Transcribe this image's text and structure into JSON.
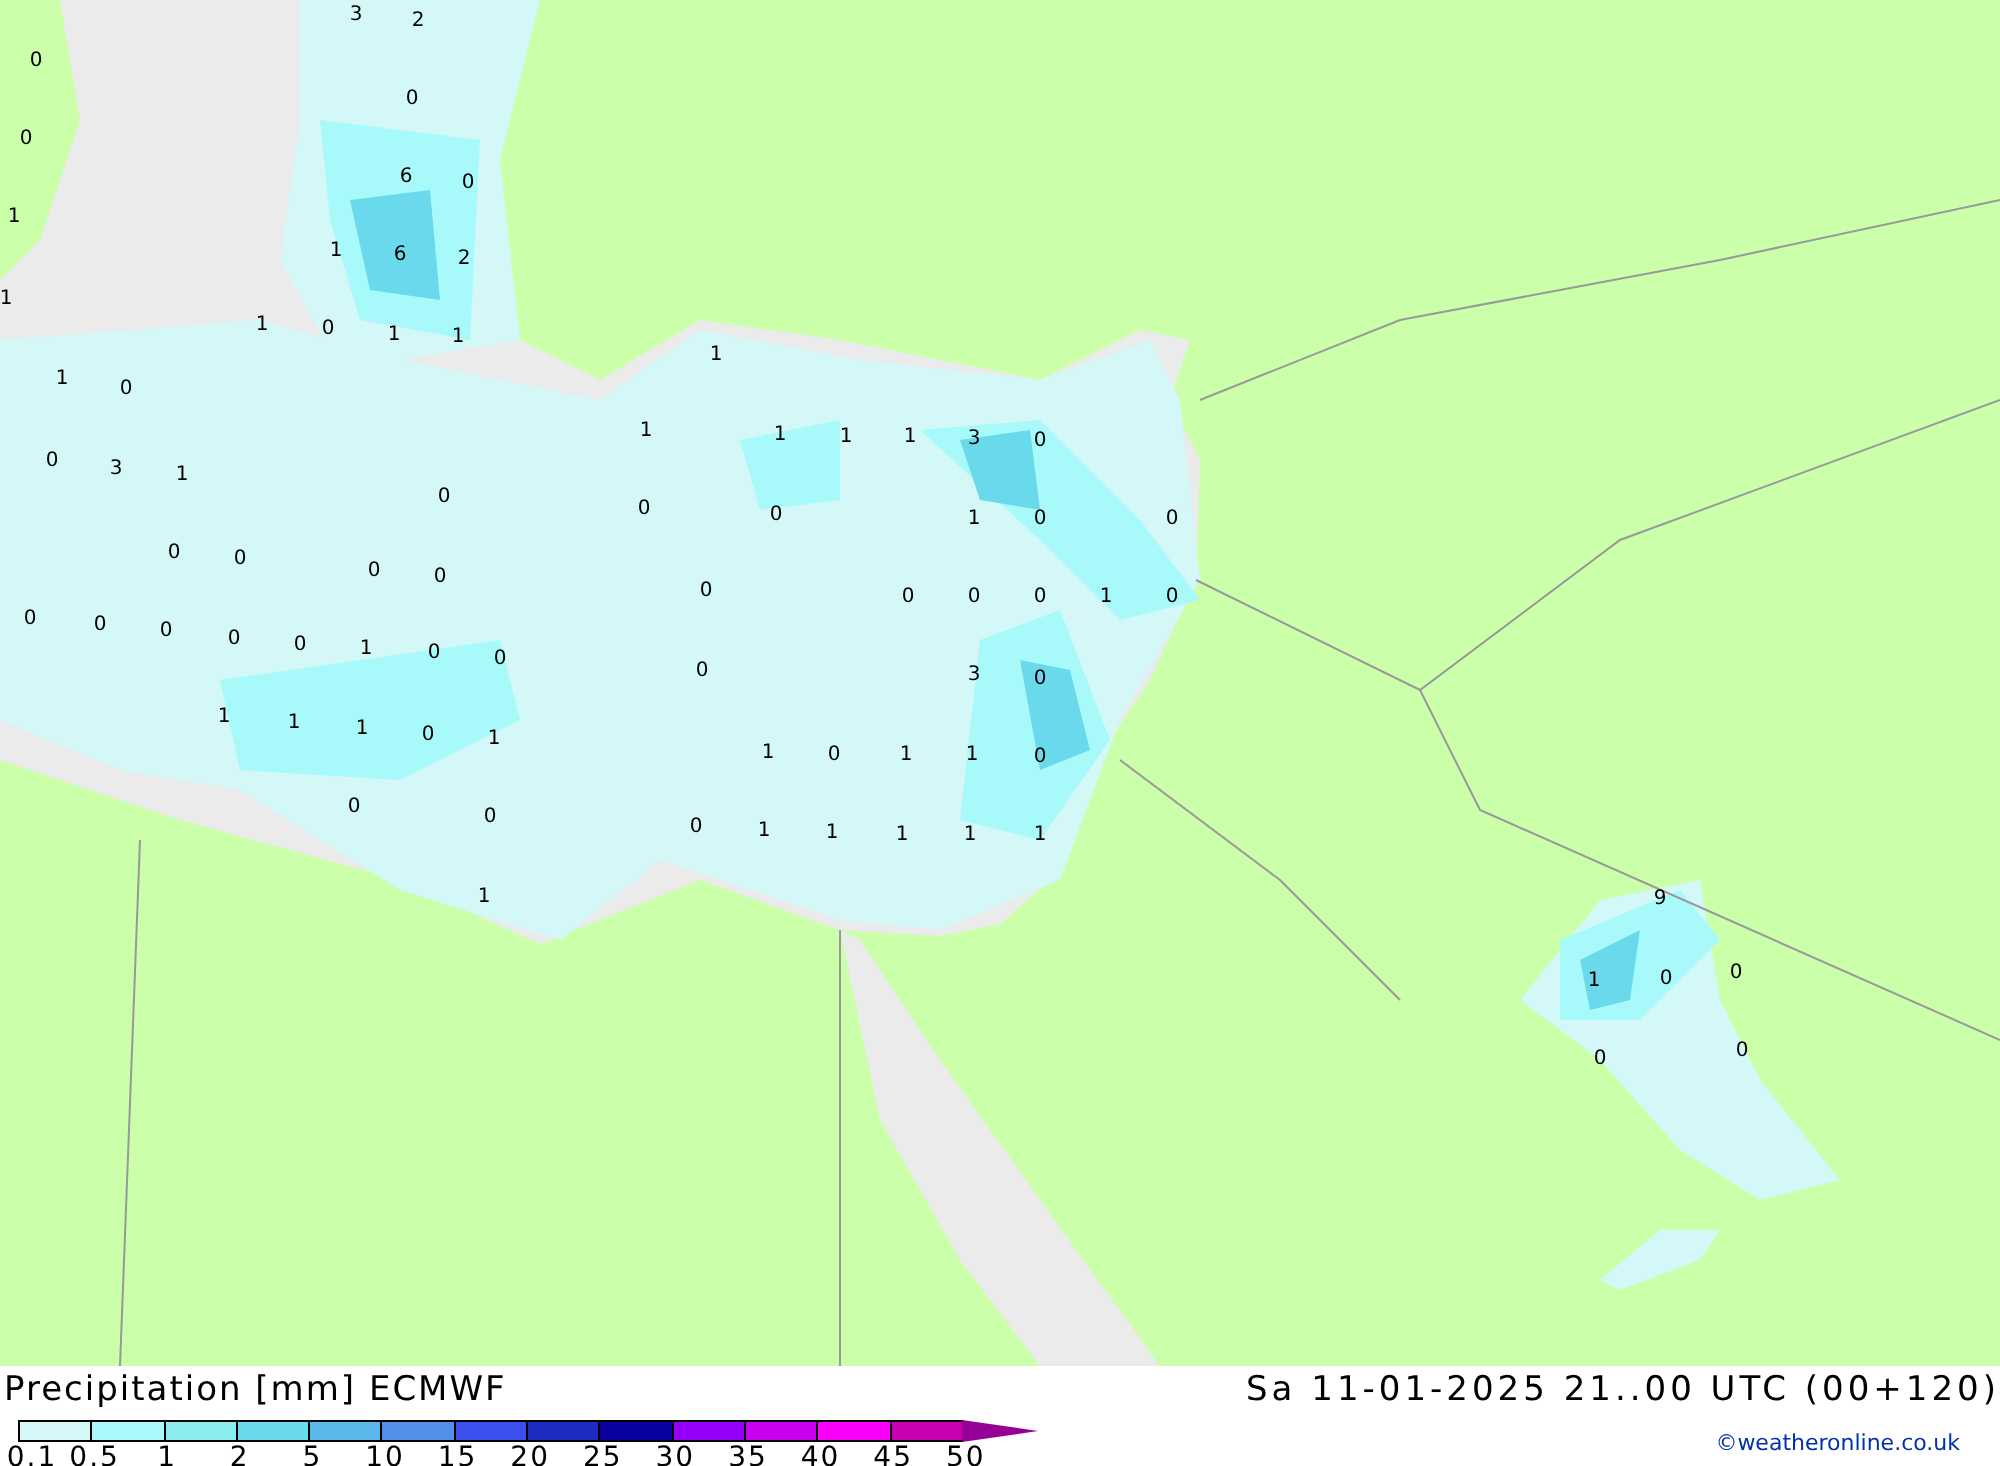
{
  "map": {
    "labels": [
      "3",
      "2",
      "0",
      "0",
      "0",
      "6",
      "0",
      "1",
      "1",
      "6",
      "2",
      "1",
      "1",
      "0",
      "1",
      "1",
      "1",
      "1",
      "0",
      "1",
      "1",
      "1",
      "1",
      "3",
      "0",
      "0",
      "3",
      "1",
      "0",
      "0",
      "0",
      "1",
      "0",
      "0",
      "0",
      "0",
      "0",
      "0",
      "0",
      "0",
      "0",
      "0",
      "1",
      "0",
      "0",
      "0",
      "0",
      "0",
      "0",
      "1",
      "0",
      "0",
      "0",
      "3",
      "0",
      "1",
      "1",
      "1",
      "0",
      "1",
      "1",
      "0",
      "1",
      "1",
      "0",
      "0",
      "0",
      "0",
      "1",
      "1",
      "1",
      "1",
      "1",
      "1",
      "9",
      "1",
      "0",
      "0",
      "0",
      "0"
    ]
  },
  "legend": {
    "title": "Precipitation [mm] ECMWF",
    "scale_colors": [
      {
        "kind": "box",
        "color": "#d4f7f7"
      },
      {
        "kind": "box",
        "color": "#a8fafa"
      },
      {
        "kind": "box",
        "color": "#8aecec"
      },
      {
        "kind": "box",
        "color": "#6ad9ec"
      },
      {
        "kind": "box",
        "color": "#5ab9ea"
      },
      {
        "kind": "box",
        "color": "#5090ea"
      },
      {
        "kind": "box",
        "color": "#3c50f0"
      },
      {
        "kind": "box",
        "color": "#1c2cc0"
      },
      {
        "kind": "box",
        "color": "#0a00a0"
      },
      {
        "kind": "box",
        "color": "#9600fa"
      },
      {
        "kind": "box",
        "color": "#c800f0"
      },
      {
        "kind": "box",
        "color": "#fa00fa"
      },
      {
        "kind": "box",
        "color": "#c800b4"
      },
      {
        "kind": "arrow",
        "color": "#960096"
      }
    ],
    "scale_labels": [
      "0.1",
      "0.5",
      "1",
      "2",
      "5",
      "10",
      "15",
      "20",
      "25",
      "30",
      "35",
      "40",
      "45",
      "50"
    ],
    "valid_time": "Sa 11-01-2025 21..00 UTC (00+120)",
    "credit": "©weatheronline.co.uk"
  }
}
